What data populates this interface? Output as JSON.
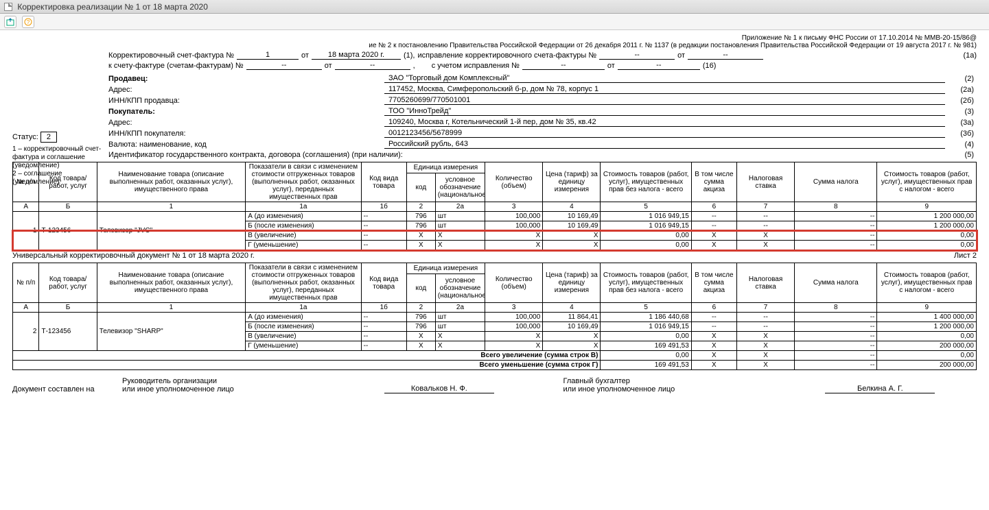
{
  "window_title": "Корректировка реализации № 1 от 18 марта 2020",
  "top_right_note": "Приложение № 1 к письму ФНС России от 17.10.2014 № ММВ-20-15/86@",
  "sub_note": "ие № 2 к постановлению Правительства Российской Федерации от 26 декабря 2011 г. № 1137 (в редакции постановления Правительства Российской Федерации от 19 августа 2017 г. № 981)",
  "line1": {
    "label1": "Корректировочный счет-фактура №",
    "num": "1",
    "ot": "от",
    "date": "18 марта 2020 г.",
    "seq": "(1),",
    "label2": "исправление корректировочного счета-фактуры №",
    "val2": "--",
    "ot2": "от",
    "val3": "--",
    "tail": "(1а)"
  },
  "line2": {
    "label1": "к счету-фактуре (счетам-фактурам) №",
    "v1": "--",
    "ot": "от",
    "v2": "--",
    "comma": ",",
    "label2": "с учетом исправления №",
    "v3": "--",
    "ot2": "от",
    "v4": "--",
    "tail": "(16)"
  },
  "status_label": "Статус:",
  "status_value": "2",
  "legend": "1 – корректировочный счет-фактура и соглашение (уведомление)\n2 – соглашение (уведомление)",
  "form": {
    "seller_k": "Продавец:",
    "seller_v": "ЗАО \"Торговый дом Комплексный\"",
    "seller_code": "(2)",
    "addr1_k": "Адрес:",
    "addr1_v": "117452, Москва, Симферопольский б-р, дом № 78, корпус 1",
    "addr1_code": "(2а)",
    "inn1_k": "ИНН/КПП продавца:",
    "inn1_v": "7705260699/770501001",
    "inn1_code": "(2б)",
    "buyer_k": "Покупатель:",
    "buyer_v": "ТОО \"ИнноТрейд\"",
    "buyer_code": "(3)",
    "addr2_k": "Адрес:",
    "addr2_v": "109240, Москва г, Котельнический 1-й пер, дом № 35, кв.42",
    "addr2_code": "(3а)",
    "inn2_k": "ИНН/КПП покупателя:",
    "inn2_v": "0012123456/5678999",
    "inn2_code": "(3б)",
    "cur_k": "Валюта: наименование, код",
    "cur_v": "Российский рубль, 643",
    "cur_code": "(4)",
    "id_k": "Идентификатор государственного контракта, договора (соглашения) (при наличии):",
    "id_code": "(5)"
  },
  "table_head": {
    "c0": "№ п/п",
    "c1": "Код товара/ работ, услуг",
    "c2": "Наименование товара (описание выполненных работ, оказанных услуг), имущественного права",
    "c3": "Показатели в связи с изменением стоимости отгруженных товаров (выполненных работ, оказанных услуг), переданных имущественных прав",
    "c4": "Код вида товара",
    "c5": "Единица измерения",
    "c5a": "код",
    "c5b": "условное обозначение (национальное)",
    "c6": "Количество (объем)",
    "c7": "Цена (тариф) за единицу измерения",
    "c8": "Стоимость товаров (работ, услуг), имущественных прав без налога - всего",
    "c9": "В том числе сумма акциза",
    "c10": "Налоговая ставка",
    "c11": "Сумма налога",
    "c12": "Стоимость товаров (работ, услуг), имущественных прав с налогом - всего"
  },
  "col_letters": [
    "А",
    "Б",
    "1",
    "1а",
    "1б",
    "2",
    "2а",
    "3",
    "4",
    "5",
    "6",
    "7",
    "8",
    "9"
  ],
  "items1": {
    "row_no": "1",
    "code": "Т-123456",
    "name": "Телевизор \"JVC\"",
    "A_label": "А (до изменения)",
    "B_label": "Б (после изменения)",
    "V_label": "В (увеличение)",
    "G_label": "Г (уменьшение)",
    "A": {
      "kv": "--",
      "ucode": "796",
      "uname": "шт",
      "qty": "100,000",
      "price": "10 169,49",
      "cost": "1 016 949,15",
      "excise": "--",
      "rate": "--",
      "tax": "--",
      "total": "1 200 000,00"
    },
    "B": {
      "kv": "--",
      "ucode": "796",
      "uname": "шт",
      "qty": "100,000",
      "price": "10 169,49",
      "cost": "1 016 949,15",
      "excise": "--",
      "rate": "--",
      "tax": "--",
      "total": "1 200 000,00"
    },
    "V": {
      "kv": "--",
      "ucode": "Х",
      "uname": "Х",
      "qty": "Х",
      "price": "Х",
      "cost": "0,00",
      "excise": "Х",
      "rate": "Х",
      "tax": "--",
      "total": "0,00"
    },
    "G": {
      "kv": "--",
      "ucode": "Х",
      "uname": "Х",
      "qty": "Х",
      "price": "Х",
      "cost": "0,00",
      "excise": "Х",
      "rate": "Х",
      "tax": "--",
      "total": "0,00"
    }
  },
  "between_title": "Универсальный корректировочный документ № 1 от 18 марта 2020 г.",
  "sheet_label": "Лист 2",
  "items2": {
    "row_no": "2",
    "code": "Т-123456",
    "name": "Телевизор \"SHARP\"",
    "A": {
      "kv": "--",
      "ucode": "796",
      "uname": "шт",
      "qty": "100,000",
      "price": "11 864,41",
      "cost": "1 186 440,68",
      "excise": "--",
      "rate": "--",
      "tax": "--",
      "total": "1 400 000,00"
    },
    "B": {
      "kv": "--",
      "ucode": "796",
      "uname": "шт",
      "qty": "100,000",
      "price": "10 169,49",
      "cost": "1 016 949,15",
      "excise": "--",
      "rate": "--",
      "tax": "--",
      "total": "1 200 000,00"
    },
    "V": {
      "kv": "--",
      "ucode": "Х",
      "uname": "Х",
      "qty": "Х",
      "price": "Х",
      "cost": "0,00",
      "excise": "Х",
      "rate": "Х",
      "tax": "--",
      "total": "0,00"
    },
    "G": {
      "kv": "--",
      "ucode": "Х",
      "uname": "Х",
      "qty": "Х",
      "price": "Х",
      "cost": "169 491,53",
      "excise": "Х",
      "rate": "Х",
      "tax": "--",
      "total": "200 000,00"
    }
  },
  "totals": {
    "inc_label": "Всего увеличение (сумма строк В)",
    "inc": {
      "cost": "0,00",
      "excise": "Х",
      "rate": "Х",
      "tax": "--",
      "total": "0,00"
    },
    "dec_label": "Всего уменьшение (сумма строк Г)",
    "dec": {
      "cost": "169 491,53",
      "excise": "Х",
      "rate": "Х",
      "tax": "--",
      "total": "200 000,00"
    }
  },
  "footer": {
    "doc_made": "Документ составлен на",
    "head_label": "Руководитель организации",
    "head_sub": "или иное уполномоченное лицо",
    "head_name": "Ковальков Н. Ф.",
    "acc_label": "Главный бухгалтер",
    "acc_sub": "или иное уполномоченное лицо",
    "acc_name": "Белкина А. Г."
  }
}
